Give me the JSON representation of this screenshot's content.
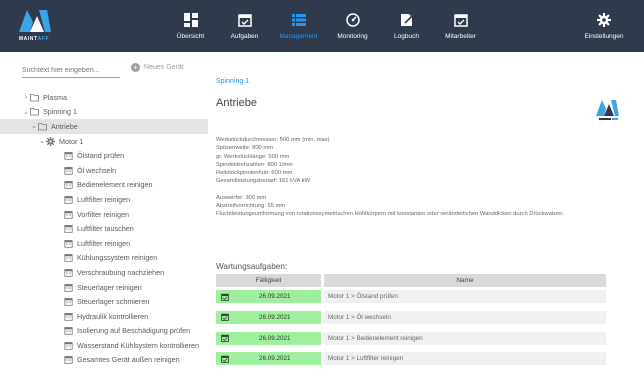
{
  "app": {
    "logo_text": "MAINT",
    "logo_text_accent": "AFF",
    "nav": [
      {
        "label": "Übersicht",
        "icon": "dashboard-icon",
        "active": false
      },
      {
        "label": "Aufgaben",
        "icon": "calendar-check-icon",
        "active": false
      },
      {
        "label": "Management",
        "icon": "list-icon",
        "active": true
      },
      {
        "label": "Monitoring",
        "icon": "gauge-icon",
        "active": false
      },
      {
        "label": "Logbuch",
        "icon": "notebook-edit-icon",
        "active": false
      },
      {
        "label": "Mitarbeiter",
        "icon": "calendar-check-icon",
        "active": false
      }
    ],
    "settings_label": "Einstellungen"
  },
  "sidebar": {
    "search_placeholder": "Suchtext hier eingeben...",
    "new_device_label": "Neues Gerät",
    "tree": [
      {
        "label": "Plasma",
        "level": 0,
        "chevron": ">",
        "icon": "folder-icon"
      },
      {
        "label": "Spinning 1",
        "level": 0,
        "chevron": "v",
        "icon": "folder-icon"
      },
      {
        "label": "Antriebe",
        "level": 1,
        "chevron": "v",
        "icon": "folder-icon",
        "selected": true
      },
      {
        "label": "Motor 1",
        "level": 2,
        "chevron": "v",
        "icon": "gear-icon"
      },
      {
        "label": "Ölstand prüfen",
        "level": 3,
        "icon": "calendar-icon"
      },
      {
        "label": "Öl wechseln",
        "level": 3,
        "icon": "calendar-icon"
      },
      {
        "label": "Bedienelement reinigen",
        "level": 3,
        "icon": "calendar-icon"
      },
      {
        "label": "Luftfilter reinigen",
        "level": 3,
        "icon": "calendar-icon"
      },
      {
        "label": "Vorfilter reinigen",
        "level": 3,
        "icon": "calendar-icon"
      },
      {
        "label": "Luftfilter tauschen",
        "level": 3,
        "icon": "calendar-icon"
      },
      {
        "label": "Luftfilter reinigen",
        "level": 3,
        "icon": "calendar-icon"
      },
      {
        "label": "Kühlungssystem reinigen",
        "level": 3,
        "icon": "calendar-icon"
      },
      {
        "label": "Verschraubung nachziehen",
        "level": 3,
        "icon": "calendar-icon"
      },
      {
        "label": "Steuerlager reinigen",
        "level": 3,
        "icon": "calendar-icon"
      },
      {
        "label": "Steuerlager schmieren",
        "level": 3,
        "icon": "calendar-icon"
      },
      {
        "label": "Hydraulik kontrollieren",
        "level": 3,
        "icon": "calendar-icon"
      },
      {
        "label": "Isolierung auf Beschädigung prüfen",
        "level": 3,
        "icon": "calendar-icon"
      },
      {
        "label": "Wasserstand Kühlsystem kontrollieren",
        "level": 3,
        "icon": "calendar-icon"
      },
      {
        "label": "Gesamtes Gerät außen reinigen",
        "level": 3,
        "icon": "calendar-icon"
      }
    ]
  },
  "main": {
    "breadcrumb": "Spinning 1",
    "title": "Antriebe",
    "specs": [
      "Werkstückdurchmesser: 500 mm (min. max)",
      "Spitzenweite: 800 mm",
      "gr. Werkstücklänge: 500 mm",
      "Spindeldrehzahlen: 800 1/min",
      "Reitstockpinolenhub: 600 mm",
      "Gesamtleistungsbedarf: 161 kVA kW",
      "",
      "Auswerfer: 300 mm",
      "Abstreifvorrichtung: 55 mm",
      "Fluchtleistungsumformung von rotationssymetrischen Hohlkörpern mit konstanten oder veränderlichen Wanddicken durch Drückwalzen."
    ],
    "tasks_label": "Wartungsaufgaben:",
    "table": {
      "headers": [
        "Fälligkeit",
        "Name"
      ],
      "rows": [
        {
          "due": "26.09.2021",
          "name": "Motor 1 > Ölstand prüfen"
        },
        {
          "due": "26.09.2021",
          "name": "Motor 1 > Öl wechseln"
        },
        {
          "due": "26.09.2021",
          "name": "Motor 1 > Bedienelement reinigen"
        },
        {
          "due": "26.09.2021",
          "name": "Motor 1 > Luftfilter reinigen"
        }
      ]
    }
  },
  "colors": {
    "topbar": "#2f3b4c",
    "accent": "#2196f3",
    "due_ok": "#9ef09e",
    "selected_row": "#e4e4e4"
  }
}
